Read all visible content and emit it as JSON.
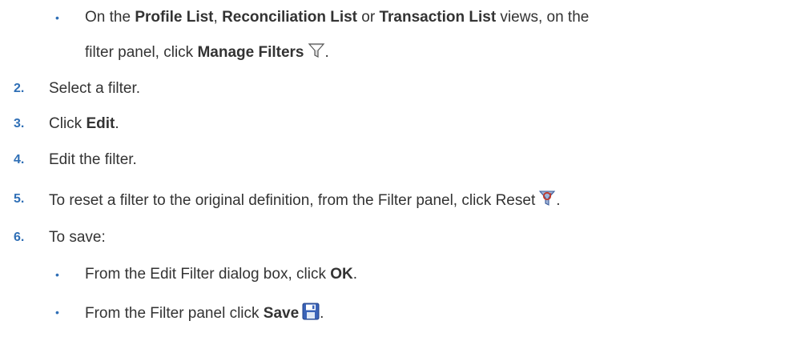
{
  "content": {
    "bullet_manage": {
      "prefix": "On the ",
      "bold1": "Profile List",
      "sep1": ", ",
      "bold2": "Reconciliation List",
      "sep2": " or ",
      "bold3": "Transaction List",
      "suffix": " views, on the",
      "line2_prefix": "filter panel, click ",
      "line2_bold": "Manage Filters",
      "line2_end": "."
    },
    "steps": [
      {
        "num": "2.",
        "text": "Select a filter."
      },
      {
        "num": "3.",
        "prefix": "Click ",
        "bold": "Edit",
        "end": "."
      },
      {
        "num": "4.",
        "text": "Edit the filter."
      },
      {
        "num": "5.",
        "text": "To reset a filter to the original definition, from the Filter panel, click Reset",
        "end": "."
      },
      {
        "num": "6.",
        "text": "To save:"
      }
    ],
    "save_bullets": [
      {
        "prefix": "From the Edit Filter dialog box, click ",
        "bold": "OK",
        "end": "."
      },
      {
        "prefix": "From the Filter panel click ",
        "bold": "Save",
        "end": "."
      }
    ],
    "bullet_char": "•"
  },
  "icons": {
    "manage_filters": "funnel-icon",
    "reset": "reset-filter-icon",
    "save": "floppy-disk-icon"
  },
  "colors": {
    "text": "#333333",
    "step_number": "#2f6fb6",
    "bullet": "#2f6fb6"
  }
}
